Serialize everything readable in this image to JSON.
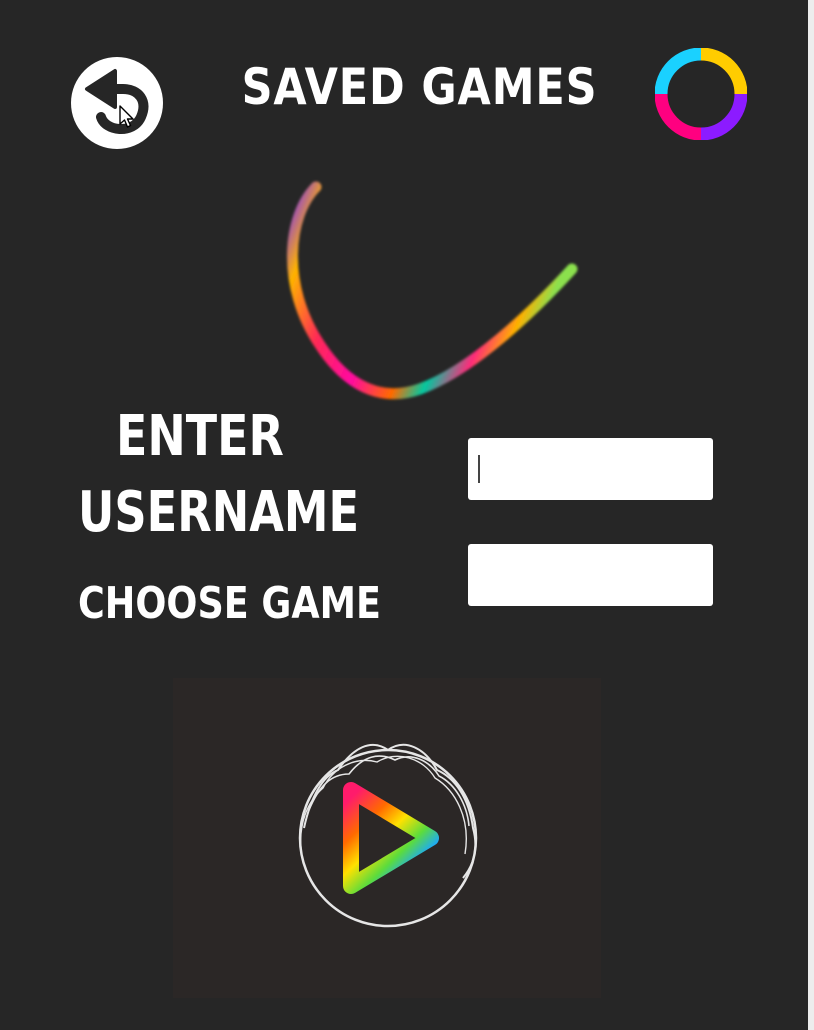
{
  "header": {
    "title": "SAVED GAMES",
    "back_icon": "undo-arrow-icon",
    "ring_icon": "color-ring-icon",
    "ring_colors": [
      "#ffcc00",
      "#8c1bff",
      "#ff0080",
      "#1ad1ff"
    ]
  },
  "form": {
    "username_label_line1": "ENTER",
    "username_label_line2": "USERNAME",
    "game_label": "CHOOSE GAME",
    "username_value": "",
    "game_value": ""
  },
  "play": {
    "icon": "play-icon"
  },
  "colors": {
    "background": "#262626",
    "panel": "#2b2726",
    "text": "#ffffff"
  }
}
